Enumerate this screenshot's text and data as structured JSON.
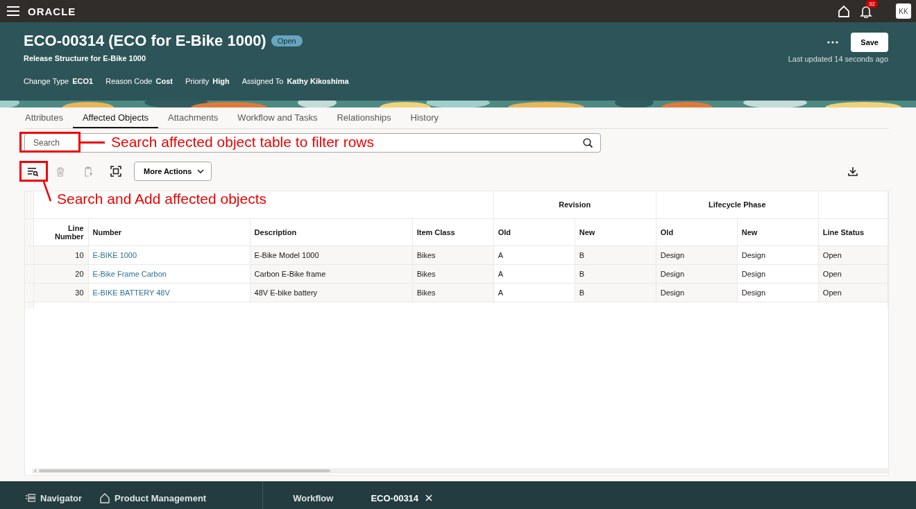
{
  "top_bar": {
    "logo": "ORACLE",
    "notification_count": "32",
    "avatar": "KK"
  },
  "record": {
    "title": "ECO-00314 (ECO for E-Bike 1000)",
    "status": "Open",
    "subtitle": "Release Structure for E-Bike 1000",
    "fields": [
      {
        "label": "Change Type",
        "value": "ECO1"
      },
      {
        "label": "Reason Code",
        "value": "Cost"
      },
      {
        "label": "Priority",
        "value": "High"
      },
      {
        "label": "Assigned To",
        "value": "Kathy Kikoshima"
      }
    ],
    "save": "Save",
    "last_updated": "Last updated 14 seconds ago"
  },
  "tabs": [
    {
      "label": "Attributes",
      "selected": false
    },
    {
      "label": "Affected Objects",
      "selected": true
    },
    {
      "label": "Attachments",
      "selected": false
    },
    {
      "label": "Workflow and Tasks",
      "selected": false
    },
    {
      "label": "Relationships",
      "selected": false
    },
    {
      "label": "History",
      "selected": false
    }
  ],
  "search": {
    "placeholder": "Search"
  },
  "toolbar": {
    "buttons": [
      {
        "kind": "search-add",
        "disabled": false
      },
      {
        "kind": "delete",
        "disabled": true
      },
      {
        "kind": "paste",
        "disabled": true
      },
      {
        "kind": "fit",
        "disabled": false
      }
    ],
    "more_actions": "More Actions"
  },
  "table": {
    "column_groups": [
      {
        "columns": [
          {
            "label": "Line Number",
            "kind": "number"
          },
          {
            "label": "Number",
            "kind": "link"
          },
          {
            "label": "Description",
            "kind": "text"
          },
          {
            "label": "Item Class",
            "kind": "text"
          }
        ]
      },
      {
        "label": "Revision",
        "columns": [
          {
            "label": "Old",
            "kind": "text"
          },
          {
            "label": "New",
            "kind": "text"
          }
        ]
      },
      {
        "label": "Lifecycle Phase",
        "columns": [
          {
            "label": "Old",
            "kind": "text"
          },
          {
            "label": "New",
            "kind": "text"
          }
        ]
      },
      {
        "columns": [
          {
            "label": "Line Status",
            "kind": "text"
          }
        ]
      }
    ],
    "rows": [
      [
        "10",
        "E-BIKE 1000",
        "E-Bike Model 1000",
        "Bikes",
        "A",
        "B",
        "Design",
        "Design",
        "Open"
      ],
      [
        "20",
        "E-Bike Frame Carbon",
        "Carbon E-Bike frame",
        "Bikes",
        "A",
        "B",
        "Design",
        "Design",
        "Open"
      ],
      [
        "30",
        "E-BIKE BATTERY 48V",
        "48V E-bike battery",
        "Bikes",
        "A",
        "B",
        "Design",
        "Design",
        "Open"
      ]
    ]
  },
  "annotations": [
    {
      "kind": "field",
      "text": "Search affected object table to filter rows"
    },
    {
      "kind": "tool",
      "text": "Search and Add affected objects"
    }
  ],
  "footer": [
    {
      "kind": "navigator",
      "label": "Navigator",
      "selected": false
    },
    {
      "kind": "home",
      "label": "Product Management",
      "selected": false
    },
    {
      "kind": "plain",
      "label": "Workflow",
      "selected": false
    },
    {
      "kind": "plain",
      "label": "ECO-00314",
      "selected": true
    }
  ]
}
